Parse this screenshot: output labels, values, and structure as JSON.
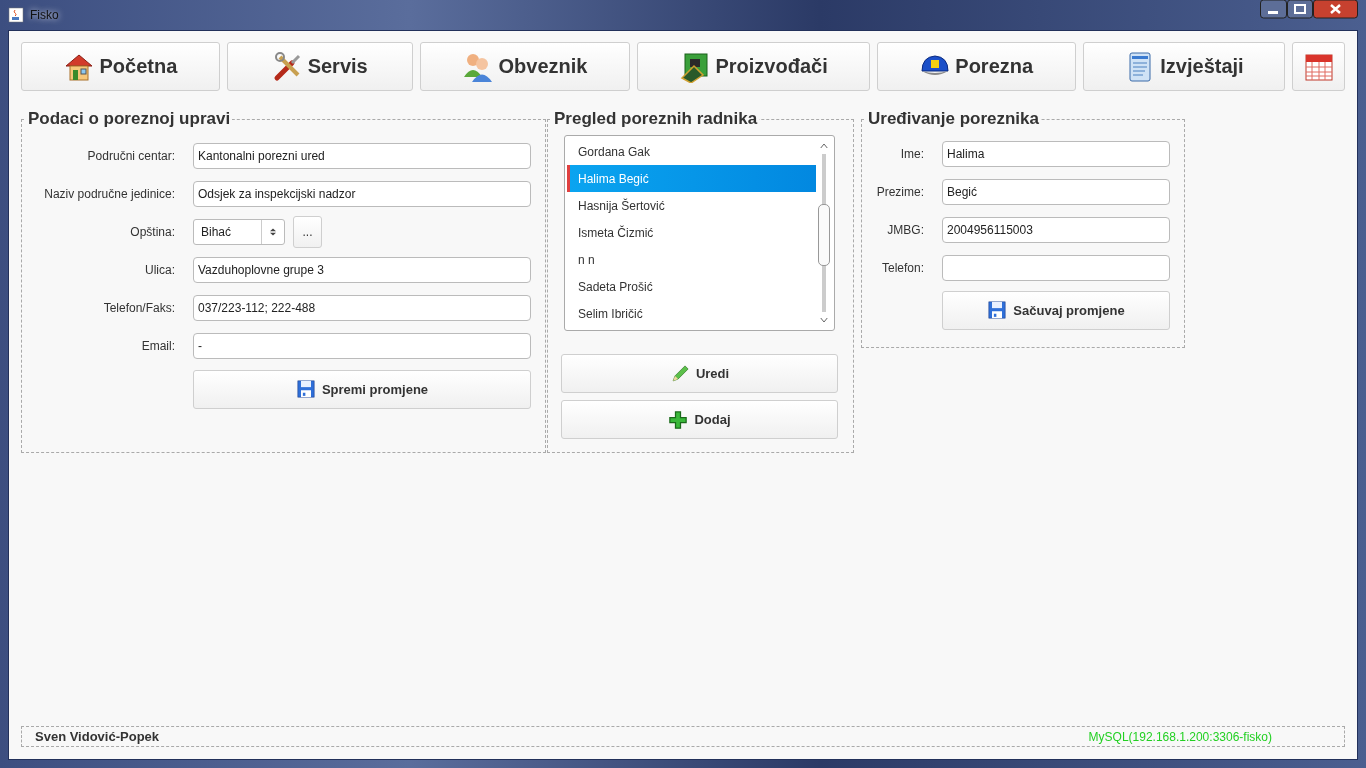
{
  "window": {
    "title": "Fisko"
  },
  "nav": [
    {
      "label": "Početna",
      "kind": "home"
    },
    {
      "label": "Servis",
      "kind": "tools"
    },
    {
      "label": "Obveznik",
      "kind": "people"
    },
    {
      "label": "Proizvođači",
      "kind": "board"
    },
    {
      "label": "Porezna",
      "kind": "cap"
    },
    {
      "label": "Izvještaji",
      "kind": "report"
    },
    {
      "kind": "calendar"
    }
  ],
  "tax_office": {
    "title": "Podaci o poreznoj upravi",
    "fields": [
      {
        "label": "Područni centar:",
        "value": "Kantonalni porezni ured",
        "kind": "text"
      },
      {
        "label": "Naziv područne jedinice:",
        "value": "Odsjek za inspekcijski nadzor",
        "kind": "text"
      },
      {
        "label": "Opština:",
        "value": "Bihać",
        "kind": "select",
        "button": "..."
      },
      {
        "label": "Ulica:",
        "value": "Vazduhoplovne grupe 3",
        "kind": "text"
      },
      {
        "label": "Telefon/Faks:",
        "value": "037/223-112; 222-488",
        "kind": "text"
      },
      {
        "label": "Email:",
        "value": "-",
        "kind": "text"
      }
    ],
    "save_button": "Spremi promjene"
  },
  "workers": {
    "title": "Pregled poreznih radnika",
    "items": [
      {
        "name": "Gordana Gak",
        "selected": false
      },
      {
        "name": "Halima Begić",
        "selected": true
      },
      {
        "name": "Hasnija Šertović",
        "selected": false
      },
      {
        "name": "Ismeta Čizmić",
        "selected": false
      },
      {
        "name": "n n",
        "selected": false
      },
      {
        "name": "Sadeta Prošić",
        "selected": false
      },
      {
        "name": "Selim Ibričić",
        "selected": false
      }
    ],
    "buttons": [
      {
        "label": "Uredi",
        "kind": "edit"
      },
      {
        "label": "Dodaj",
        "kind": "add"
      }
    ]
  },
  "editor": {
    "title": "Uređivanje poreznika",
    "fields": [
      {
        "label": "Ime:",
        "value": "Halima"
      },
      {
        "label": "Prezime:",
        "value": "Begić"
      },
      {
        "label": "JMBG:",
        "value": "2004956115003"
      },
      {
        "label": "Telefon:"
      }
    ],
    "save_button": "Sačuvaj promjene"
  },
  "status_bar": {
    "user": "Sven Vidović-Popek",
    "connection": "MySQL(192.168.1.200:3306-fisko)"
  }
}
